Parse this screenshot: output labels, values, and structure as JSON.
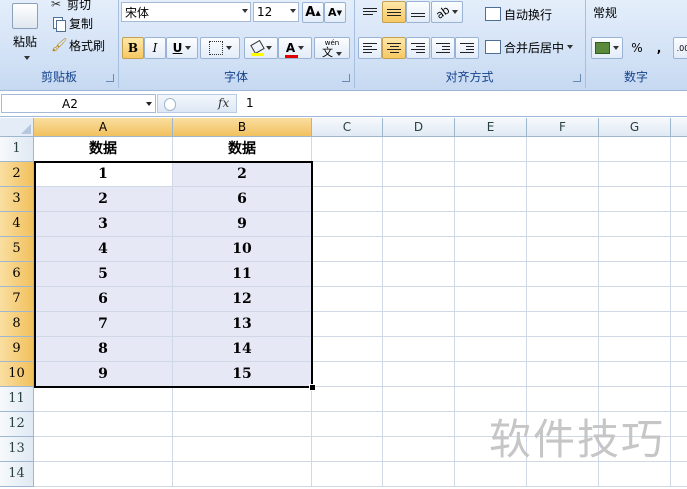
{
  "ribbon": {
    "clipboard": {
      "label": "剪贴板",
      "paste": "粘贴",
      "cut": "剪切",
      "copy": "复制",
      "format_painter": "格式刷"
    },
    "font": {
      "label": "字体",
      "font_name": "宋体",
      "font_size": "12",
      "bold": "B",
      "italic": "I",
      "underline": "U",
      "grow": "A",
      "shrink": "A",
      "font_color": "A",
      "phonetic": "wén"
    },
    "alignment": {
      "label": "对齐方式",
      "wrap_text": "自动换行",
      "merge_center": "合并后居中"
    },
    "number": {
      "label": "数字",
      "format": "常规",
      "percent": "%",
      "comma": ","
    }
  },
  "formula_bar": {
    "name_box": "A2",
    "fx": "fx",
    "value": "1"
  },
  "sheet": {
    "columns": [
      "A",
      "B",
      "C",
      "D",
      "E",
      "F",
      "G"
    ],
    "rows": [
      "1",
      "2",
      "3",
      "4",
      "5",
      "6",
      "7",
      "8",
      "9",
      "10",
      "11",
      "12",
      "13",
      "14"
    ],
    "headers": [
      "数据",
      "数据"
    ],
    "data": [
      [
        "1",
        "2"
      ],
      [
        "2",
        "6"
      ],
      [
        "3",
        "9"
      ],
      [
        "4",
        "10"
      ],
      [
        "5",
        "11"
      ],
      [
        "6",
        "12"
      ],
      [
        "7",
        "13"
      ],
      [
        "8",
        "14"
      ],
      [
        "9",
        "15"
      ]
    ],
    "selection": "A2:B10",
    "active_cell": "A2"
  },
  "watermark": "软件技巧",
  "colors": {
    "ribbon_bg": "#d3e2f6",
    "group_label": "#15428b",
    "selected_header": "#f2c15e",
    "range_fill": "#e6e9f5",
    "gridline": "#d0d7e5"
  }
}
